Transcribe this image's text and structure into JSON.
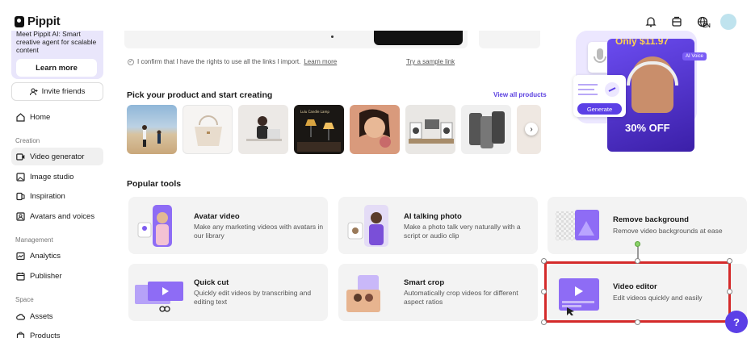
{
  "app": {
    "name": "Pippit"
  },
  "sidebar": {
    "promo_text": "Meet Pippit AI: Smart creative agent for scalable content",
    "promo_button": "Learn more",
    "invite_label": "Invite friends",
    "home_label": "Home",
    "section_creation": "Creation",
    "section_management": "Management",
    "section_space": "Space",
    "items": [
      {
        "label": "Video generator",
        "icon": "video-icon",
        "active": true
      },
      {
        "label": "Image studio",
        "icon": "image-icon"
      },
      {
        "label": "Inspiration",
        "icon": "inspiration-icon"
      },
      {
        "label": "Avatars and voices",
        "icon": "avatar-icon"
      },
      {
        "label": "Analytics",
        "icon": "analytics-icon"
      },
      {
        "label": "Publisher",
        "icon": "calendar-icon"
      },
      {
        "label": "Assets",
        "icon": "cloud-icon"
      },
      {
        "label": "Products",
        "icon": "bag-icon"
      }
    ]
  },
  "header": {
    "lang": "EN"
  },
  "main": {
    "confirm_text": "I confirm that I have the rights to use all the links I import.",
    "confirm_link": "Learn more",
    "sample_link": "Try a sample link",
    "products_title": "Pick your product and start creating",
    "view_all": "View all products",
    "popular_title": "Popular tools",
    "banner": {
      "offer_top": "Only $11.97",
      "off": "30% OFF",
      "generate": "Generate",
      "ai_voice": "AI Voice"
    },
    "tools": [
      {
        "title": "Avatar video",
        "desc": "Make any marketing videos with avatars in our library"
      },
      {
        "title": "AI talking photo",
        "desc": "Make a photo talk very naturally with a script or audio clip"
      },
      {
        "title": "Remove background",
        "desc": "Remove video backgrounds at ease"
      },
      {
        "title": "Quick cut",
        "desc": "Quickly edit videos by transcribing and editing text"
      },
      {
        "title": "Smart crop",
        "desc": "Automatically crop videos for different aspect ratios"
      },
      {
        "title": "Video editor",
        "desc": "Edit videos quickly and easily"
      }
    ]
  },
  "colors": {
    "accent": "#5b3fe6",
    "highlight": "#d42a2a"
  }
}
